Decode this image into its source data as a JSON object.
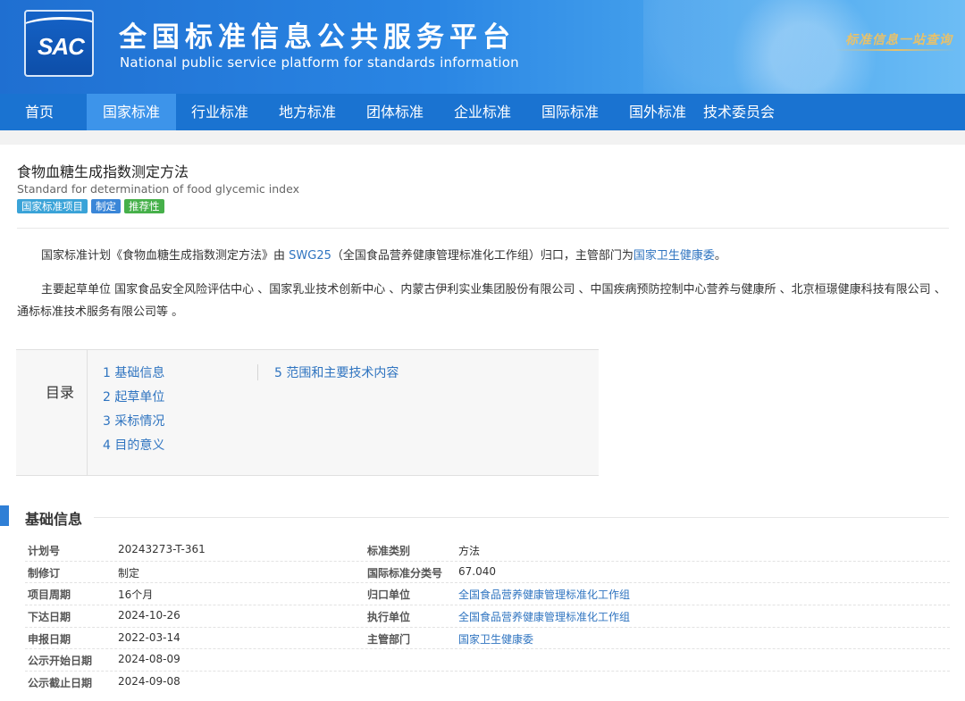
{
  "header": {
    "logo_text": "SAC",
    "title_cn": "全国标准信息公共服务平台",
    "title_en": "National public service platform  for standards information",
    "slogan": "标准信息一站查询"
  },
  "nav": {
    "items": [
      "首页",
      "国家标准",
      "行业标准",
      "地方标准",
      "团体标准",
      "企业标准",
      "国际标准",
      "国外标准",
      "技术委员会"
    ],
    "active_index": 1
  },
  "standard": {
    "title_cn": "食物血糖生成指数测定方法",
    "title_en": "Standard for determination of food glycemic index",
    "tags": [
      "国家标准项目",
      "制定",
      "推荐性"
    ]
  },
  "desc": {
    "p1_a": "国家标准计划《食物血糖生成指数测定方法》由 ",
    "p1_link1": "SWG25",
    "p1_b": "（全国食品营养健康管理标准化工作组）归口，主管部门为",
    "p1_link2": "国家卫生健康委",
    "p1_c": "。",
    "p2": "主要起草单位 国家食品安全风险评估中心 、国家乳业技术创新中心 、内蒙古伊利实业集团股份有限公司 、中国疾病预防控制中心营养与健康所 、北京桓璟健康科技有限公司 、通标标准技术服务有限公司等 。"
  },
  "toc": {
    "label": "目录",
    "col1": [
      "1  基础信息",
      "2  起草单位",
      "3  采标情况",
      "4  目的意义"
    ],
    "col2": [
      "5  范围和主要技术内容"
    ]
  },
  "section": {
    "title": "基础信息"
  },
  "info": {
    "rows": [
      {
        "l1": "计划号",
        "v1": "20243273-T-361",
        "l2": "标准类别",
        "v2": "方法"
      },
      {
        "l1": "制修订",
        "v1": "制定",
        "l2": "国际标准分类号",
        "v2": "67.040"
      },
      {
        "l1": "项目周期",
        "v1": "16个月",
        "l2": "归口单位",
        "v2": "全国食品营养健康管理标准化工作组"
      },
      {
        "l1": "下达日期",
        "v1": "2024-10-26",
        "l2": "执行单位",
        "v2": "全国食品营养健康管理标准化工作组"
      },
      {
        "l1": "申报日期",
        "v1": "2022-03-14",
        "l2": "主管部门",
        "v2": "国家卫生健康委"
      },
      {
        "l1": "公示开始日期",
        "v1": "2024-08-09",
        "l2": "",
        "v2": ""
      },
      {
        "l1": "公示截止日期",
        "v1": "2024-09-08",
        "l2": "",
        "v2": ""
      }
    ]
  },
  "colors": {
    "nav_bg": "#1a73d1",
    "nav_active": "#3d94ea",
    "link": "#2f74c0"
  }
}
